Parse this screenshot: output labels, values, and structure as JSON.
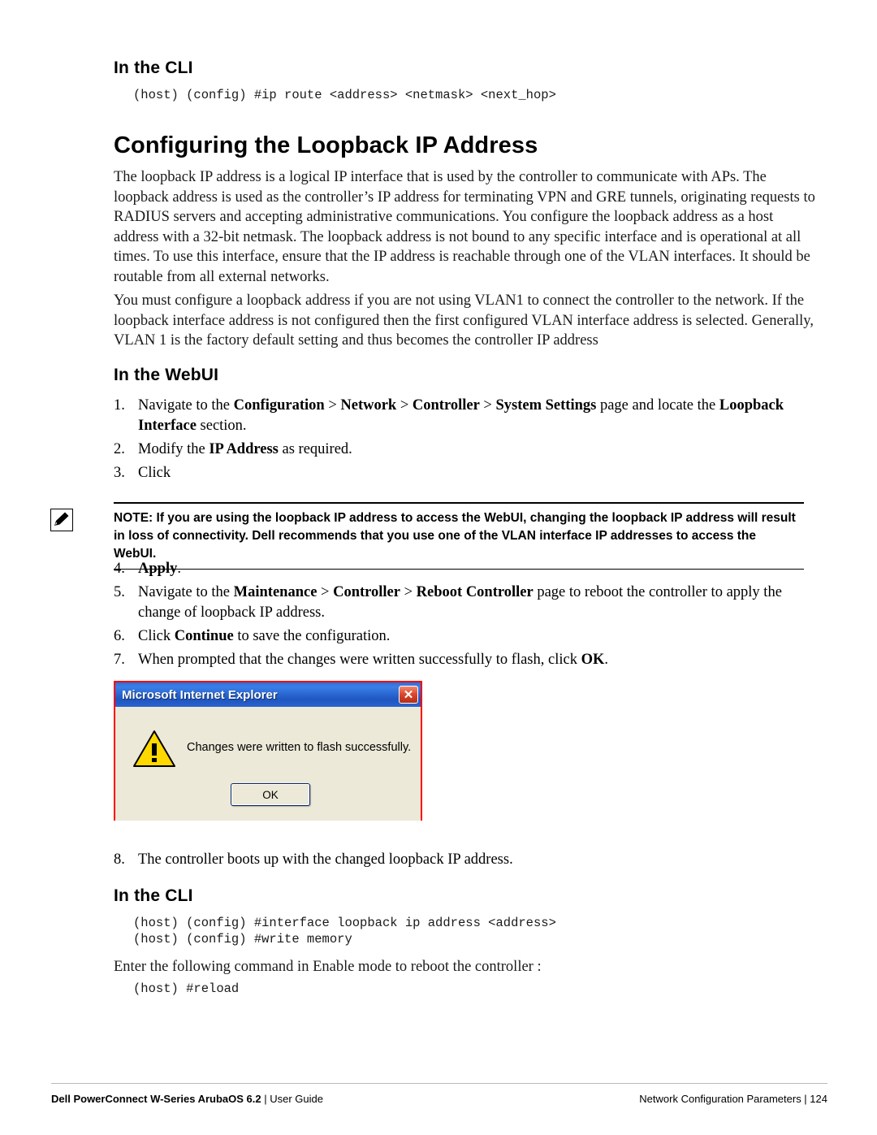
{
  "sections": {
    "cli_head_1": "In the CLI",
    "cli_code_1": "(host) (config) #ip route <address> <netmask> <next_hop>",
    "chapter_title": "Configuring the Loopback IP Address",
    "para_1": "The loopback IP address is a logical IP interface that is used by the controller to communicate with APs. The loopback address is used as the controller’s IP address for terminating VPN and GRE tunnels, originating requests to RADIUS servers and accepting administrative communications. You configure the loopback address as a host address with a 32-bit netmask. The loopback address is not bound to any specific interface and is operational at all times. To use this interface, ensure that the IP address is reachable through one of the VLAN interfaces. It should be routable from all external networks.",
    "para_2": "You must configure a loopback address if you are not using VLAN1 to connect the controller to the network. If the loopback interface address is not configured then the first configured VLAN interface address is selected. Generally, VLAN 1 is the factory default setting and thus becomes the controller IP address",
    "webui_head": "In the WebUI",
    "cli_head_2": "In the CLI",
    "cli_code_2_line1": "(host) (config) #interface loopback ip address <address>",
    "cli_code_2_line2": "(host) (config) #write memory",
    "para_3": "Enter the following command in Enable mode to reboot the controller :",
    "cli_code_3": "(host) #reload"
  },
  "steps_before_note": [
    {
      "num": "1.",
      "html": "Navigate to the <b>Configuration</b> > <b>Network</b> > <b>Controller</b> > <b>System Settings</b> page and locate the <b>Loopback Interface</b> section."
    },
    {
      "num": "2.",
      "html": "Modify the <b>IP Address</b> as required."
    },
    {
      "num": "3.",
      "html": "Click"
    }
  ],
  "note": {
    "text": "NOTE: If you are using the loopback IP address to access the WebUI, changing the loopback IP address will result in loss of connectivity. Dell recommends that you use one of the VLAN interface IP addresses to access the WebUI."
  },
  "steps_after_note": [
    {
      "num": "4.",
      "html": "<b>Apply</b>."
    },
    {
      "num": "5.",
      "html": "Navigate to the <b>Maintenance</b> > <b>Controller</b> > <b>Reboot Controller</b> page to reboot the controller to apply the change of loopback IP address."
    },
    {
      "num": "6.",
      "html": "Click <b>Continue</b> to save the configuration."
    },
    {
      "num": "7.",
      "html": "When prompted that the changes were written successfully to flash, click <b>OK</b>."
    }
  ],
  "steps_after_dialog": [
    {
      "num": "8.",
      "html": "The controller boots up with the changed loopback IP address."
    }
  ],
  "dialog": {
    "title": "Microsoft Internet Explorer",
    "message": "Changes were written to flash successfully.",
    "ok_label": "OK",
    "close_label": "✕"
  },
  "footer": {
    "left_bold": "Dell PowerConnect W-Series ArubaOS 6.2",
    "left_rest": " | User Guide",
    "right": "Network Configuration Parameters |  124"
  },
  "colors": {
    "title_blue": "#1f56c0",
    "dialog_border_red": "#ff0000",
    "dialog_face": "#ece9d8"
  }
}
